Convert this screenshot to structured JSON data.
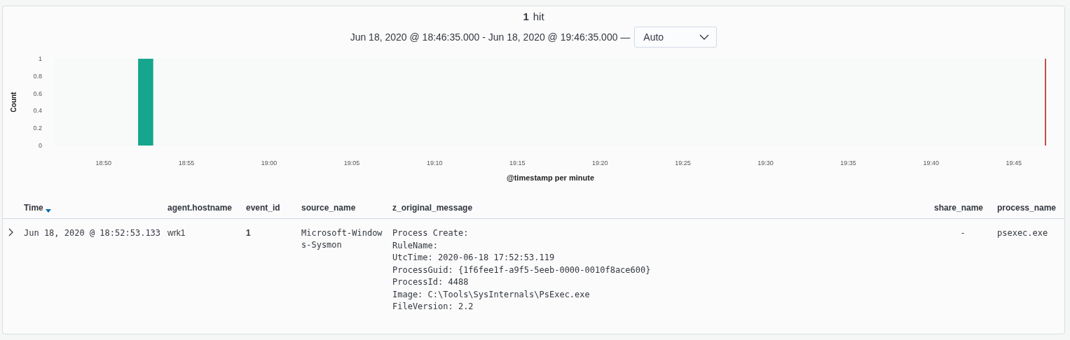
{
  "hits": {
    "count": "1",
    "label": "hit"
  },
  "time_range": {
    "text": "Jun 18, 2020 @ 18:46:35.000 - Jun 18, 2020 @ 19:46:35.000 —",
    "interval": "Auto"
  },
  "histogram": {
    "current_time_marker": true,
    "chart_data": {
      "type": "bar",
      "ylabel": "Count",
      "xlabel": "@timestamp per minute",
      "ylim": [
        0,
        1
      ],
      "yticks": [
        0,
        0.2,
        0.4,
        0.6,
        0.8,
        1
      ],
      "categories": [
        null,
        null,
        null,
        "18:50",
        null,
        null,
        null,
        null,
        "18:55",
        null,
        null,
        null,
        null,
        "19:00",
        null,
        null,
        null,
        null,
        "19:05",
        null,
        null,
        null,
        null,
        "19:10",
        null,
        null,
        null,
        null,
        "19:15",
        null,
        null,
        null,
        null,
        "19:20",
        null,
        null,
        null,
        null,
        "19:25",
        null,
        null,
        null,
        null,
        "19:30",
        null,
        null,
        null,
        null,
        "19:35",
        null,
        null,
        null,
        null,
        "19:40",
        null,
        null,
        null,
        null,
        "19:45",
        null
      ],
      "series": [
        {
          "color": "#16a58e",
          "values": [
            0,
            0,
            0,
            0,
            0,
            1,
            0,
            0,
            0,
            0,
            0,
            0,
            0,
            0,
            0,
            0,
            0,
            0,
            0,
            0,
            0,
            0,
            0,
            0,
            0,
            0,
            0,
            0,
            0,
            0,
            0,
            0,
            0,
            0,
            0,
            0,
            0,
            0,
            0,
            0,
            0,
            0,
            0,
            0,
            0,
            0,
            0,
            0,
            0,
            0,
            0,
            0,
            0,
            0,
            0,
            0,
            0,
            0,
            0,
            0
          ]
        }
      ]
    }
  },
  "table": {
    "columns": [
      {
        "label": "Time",
        "sorted": true
      },
      {
        "label": "agent.hostname",
        "sorted": false
      },
      {
        "label": "event_id",
        "sorted": false
      },
      {
        "label": "source_name",
        "sorted": false
      },
      {
        "label": "z_original_message",
        "sorted": false
      },
      {
        "label": "share_name",
        "sorted": false
      },
      {
        "label": "process_name",
        "sorted": false
      }
    ],
    "rows": [
      {
        "expanded": false,
        "cells": [
          {
            "kind": "mono",
            "text": "Jun 18, 2020 @ 18:52:53.133"
          },
          {
            "kind": "plain",
            "text": "wrk1"
          },
          {
            "kind": "bold",
            "text": "1"
          },
          {
            "kind": "mono",
            "text": "Microsoft-Windows-Sysmon"
          },
          {
            "kind": "lines",
            "lines": [
              "Process Create:",
              "RuleName:",
              "UtcTime: 2020-06-18 17:52:53.119",
              "ProcessGuid: {1f6fee1f-a9f5-5eeb-0000-0010f8ace600}",
              "ProcessId: 4488",
              "Image: C:\\Tools\\SysInternals\\PsExec.exe",
              "FileVersion: 2.2"
            ]
          },
          {
            "kind": "center",
            "text": "-"
          },
          {
            "kind": "mono",
            "text": "psexec.exe"
          }
        ]
      }
    ]
  }
}
